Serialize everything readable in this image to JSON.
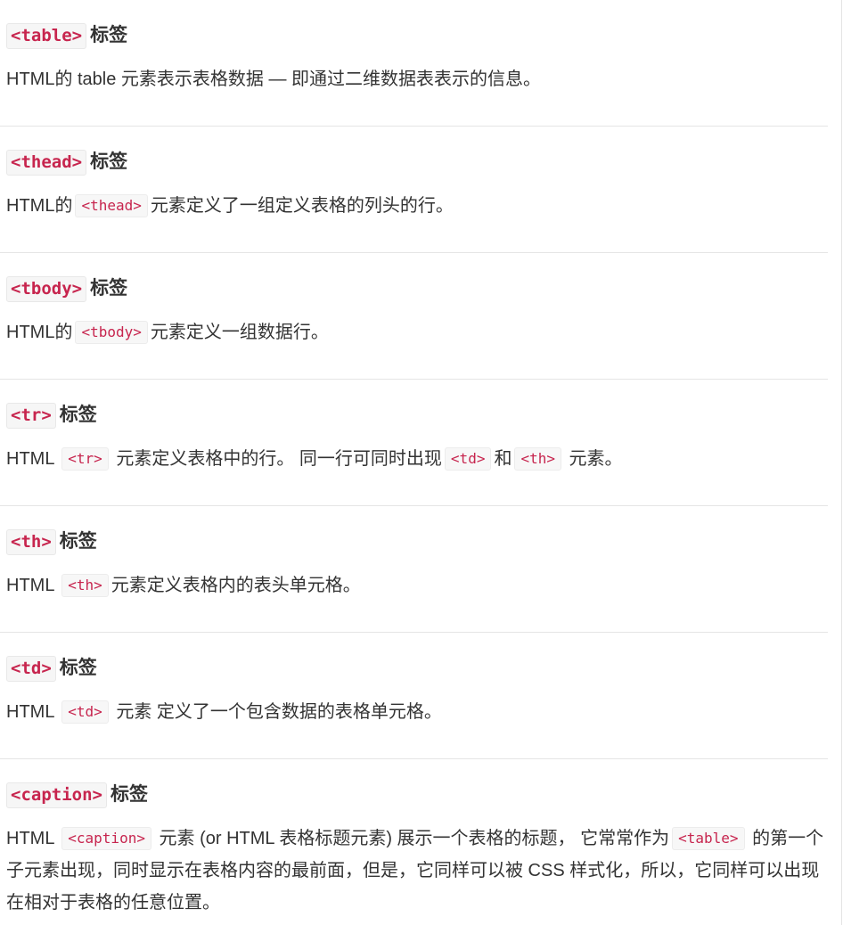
{
  "sections": [
    {
      "tag": "<table>",
      "suffix": "标签",
      "desc": {
        "p1": "HTML的 table 元素表示表格数据 — 即通过二维数据表表示的信息。"
      }
    },
    {
      "tag": "<thead>",
      "suffix": "标签",
      "desc": {
        "p1": "HTML的",
        "c1": "<thead>",
        "p2": "元素定义了一组定义表格的列头的行。"
      }
    },
    {
      "tag": "<tbody>",
      "suffix": "标签",
      "desc": {
        "p1": "HTML的",
        "c1": "<tbody>",
        "p2": "元素定义一组数据行。"
      }
    },
    {
      "tag": "<tr>",
      "suffix": "标签",
      "desc": {
        "p1": "HTML ",
        "c1": "<tr>",
        "p2": " 元素定义表格中的行。 同一行可同时出现",
        "c2": "<td>",
        "p3": "和",
        "c3": "<th>",
        "p4": " 元素。"
      }
    },
    {
      "tag": "<th>",
      "suffix": "标签",
      "desc": {
        "p1": "HTML ",
        "c1": "<th>",
        "p2": "元素定义表格内的表头单元格。"
      }
    },
    {
      "tag": "<td>",
      "suffix": "标签",
      "desc": {
        "p1": "HTML ",
        "c1": "<td>",
        "p2": " 元素 定义了一个包含数据的表格单元格。"
      }
    },
    {
      "tag": "<caption>",
      "suffix": "标签",
      "desc": {
        "p1": "HTML ",
        "c1": "<caption>",
        "p2": " 元素 (or HTML 表格标题元素) 展示一个表格的标题， 它常常作为",
        "c2": "<table>",
        "p3": " 的第一个子元素出现，同时显示在表格内容的最前面，但是，它同样可以被 CSS 样式化，所以，它同样可以出现在相对于表格的任意位置。"
      }
    }
  ]
}
